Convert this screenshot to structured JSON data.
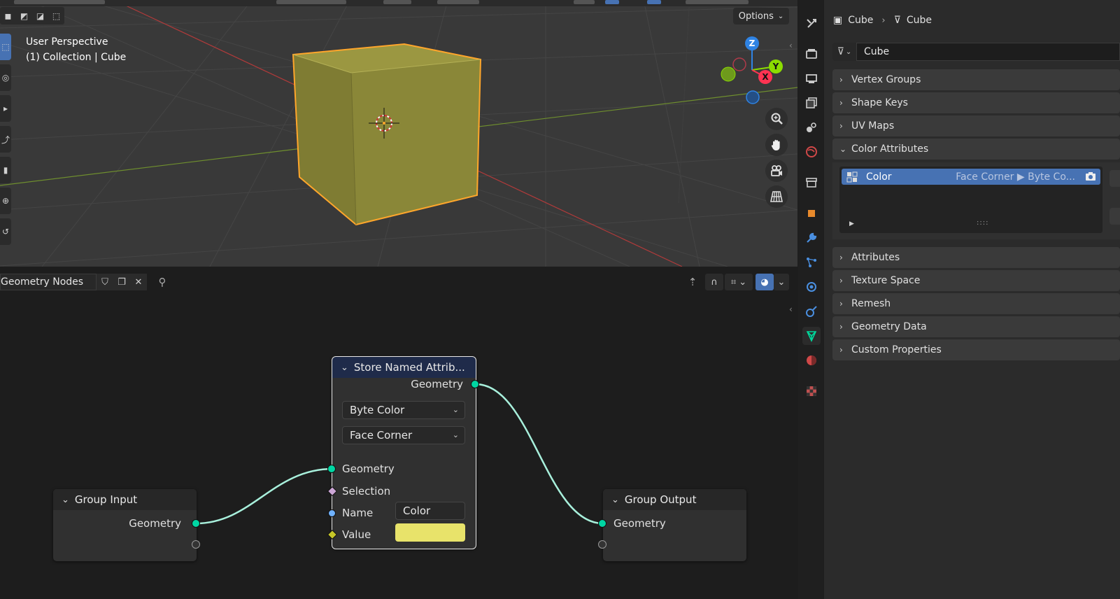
{
  "viewport": {
    "view_name": "User Perspective",
    "collection_line": "(1) Collection | Cube",
    "options_label": "Options",
    "gizmo": {
      "z": "Z",
      "y": "Y",
      "x": "X"
    },
    "colors": {
      "background": "#393939",
      "cube_face": "#8a8738",
      "selection_outline": "#ffa62b",
      "x_axis": "#ff3352",
      "y_axis": "#8bdc00",
      "z_axis": "#2f83e3"
    }
  },
  "node_editor": {
    "tree_name": "Geometry Nodes",
    "group_input": {
      "title": "Group Input",
      "output_geometry": "Geometry"
    },
    "store_attribute": {
      "title": "Store Named Attrib...",
      "output_geometry": "Geometry",
      "data_type": "Byte Color",
      "domain": "Face Corner",
      "input_geometry": "Geometry",
      "input_selection": "Selection",
      "input_name": "Name",
      "name_value": "Color",
      "input_value": "Value",
      "value_color": "#e8e36a"
    },
    "group_output": {
      "title": "Group Output",
      "input_geometry": "Geometry"
    },
    "colors": {
      "link": "#a8f0dc",
      "geometry_socket": "#00d6a3",
      "selection_socket": "#cca6d6",
      "string_socket": "#70b2ff",
      "value_socket": "#c7c729"
    }
  },
  "properties": {
    "breadcrumb": {
      "object": "Cube",
      "mesh": "Cube"
    },
    "mesh_name": "Cube",
    "panels": {
      "vertex_groups": "Vertex Groups",
      "shape_keys": "Shape Keys",
      "uv_maps": "UV Maps",
      "color_attributes": "Color Attributes",
      "attributes": "Attributes",
      "texture_space": "Texture Space",
      "remesh": "Remesh",
      "geometry_data": "Geometry Data",
      "custom_properties": "Custom Properties"
    },
    "color_attribute_list": [
      {
        "name": "Color",
        "info": "Face Corner ▶ Byte Co..."
      }
    ],
    "colors": {
      "accent": "#4772b3"
    }
  }
}
